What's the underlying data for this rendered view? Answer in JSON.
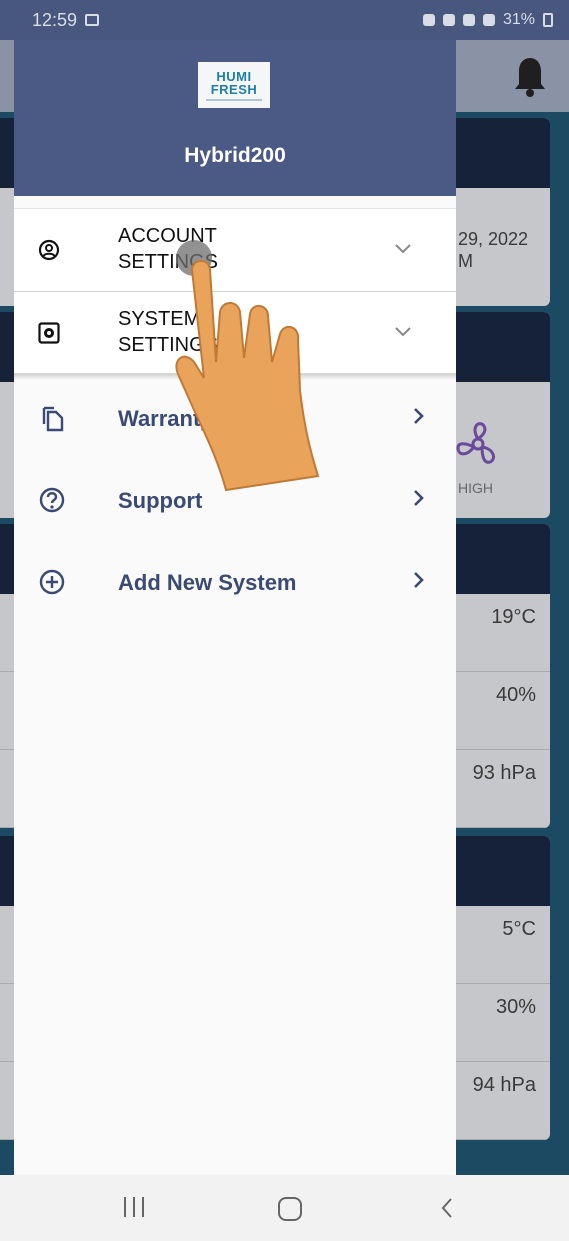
{
  "status_bar": {
    "time": "12:59",
    "battery": "31%"
  },
  "background_app": {
    "date_line1": "29, 2022",
    "date_line2": "M",
    "fan_label": "HIGH",
    "card1": [
      "19°C",
      "40%",
      "93 hPa"
    ],
    "card2": [
      "5°C",
      "30%",
      "94 hPa"
    ]
  },
  "drawer": {
    "logo_line1": "HUMI",
    "logo_line2": "FRESH",
    "device_name": "Hybrid200",
    "expandable_items": [
      {
        "label": "ACCOUNT SETTINGS",
        "icon": "account-circle-icon"
      },
      {
        "label": "SYSTEM SETTINGS",
        "icon": "settings-box-icon"
      }
    ],
    "nav_items": [
      {
        "label": "Warranty",
        "icon": "copy-document-icon"
      },
      {
        "label": "Support",
        "icon": "help-circle-icon"
      },
      {
        "label": "Add New System",
        "icon": "add-circle-icon"
      }
    ]
  },
  "colors": {
    "drawer_header": "#4a5a84",
    "menu_text": "#3a4a74",
    "hand": "#e9a35b"
  }
}
